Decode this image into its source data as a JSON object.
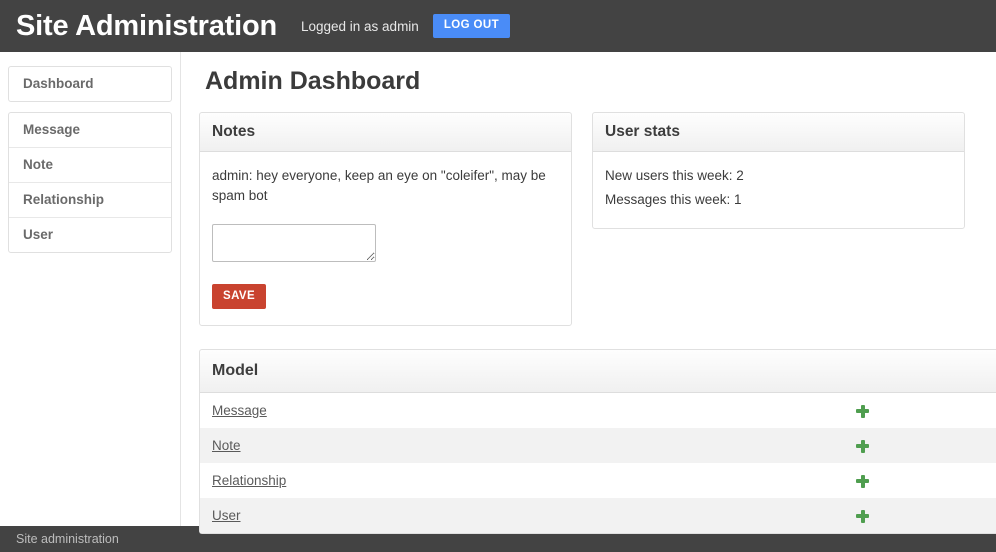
{
  "header": {
    "brand_title": "Site Administration",
    "logged_in_text": "Logged in as admin",
    "logout_label": "LOG OUT",
    "bg_color": "#434343",
    "logout_color": "#4a8cf7"
  },
  "sidebar": {
    "primary": [
      {
        "label": "Dashboard"
      }
    ],
    "models": [
      {
        "label": "Message"
      },
      {
        "label": "Note"
      },
      {
        "label": "Relationship"
      },
      {
        "label": "User"
      }
    ]
  },
  "main": {
    "page_title": "Admin Dashboard",
    "notes_panel": {
      "title": "Notes",
      "entries": [
        "admin: hey everyone, keep an eye on \"coleifer\", may be spam bot"
      ],
      "textarea_value": "",
      "textarea_placeholder": "",
      "save_label": "SAVE",
      "save_color": "#c9432f"
    },
    "user_stats_panel": {
      "title": "User stats",
      "lines": [
        "New users this week: 2",
        "Messages this week: 1"
      ]
    },
    "model_panel": {
      "title": "Model",
      "add_icon": "plus-icon",
      "add_icon_color": "#4f9e4f",
      "rows": [
        {
          "name": "Message"
        },
        {
          "name": "Note"
        },
        {
          "name": "Relationship"
        },
        {
          "name": "User"
        }
      ]
    }
  },
  "footer": {
    "text": "Site administration"
  }
}
